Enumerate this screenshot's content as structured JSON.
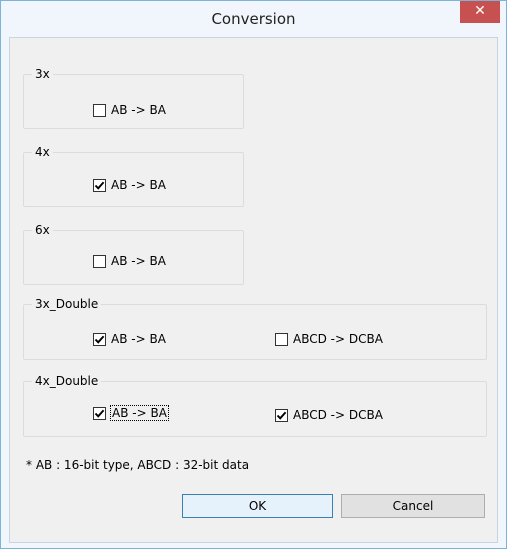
{
  "window": {
    "title": "Conversion",
    "close_glyph": "✕"
  },
  "groups": [
    {
      "legend": "3x",
      "options": [
        {
          "label": "AB -> BA",
          "checked": false
        }
      ]
    },
    {
      "legend": "4x",
      "options": [
        {
          "label": "AB -> BA",
          "checked": true
        }
      ]
    },
    {
      "legend": "6x",
      "options": [
        {
          "label": "AB -> BA",
          "checked": false
        }
      ]
    },
    {
      "legend": "3x_Double",
      "options": [
        {
          "label": "AB -> BA",
          "checked": true
        },
        {
          "label": "ABCD -> DCBA",
          "checked": false
        }
      ]
    },
    {
      "legend": "4x_Double",
      "options": [
        {
          "label": "AB -> BA",
          "checked": true
        },
        {
          "label": "ABCD -> DCBA",
          "checked": true
        }
      ]
    }
  ],
  "note": "* AB : 16-bit type, ABCD : 32-bit data",
  "buttons": {
    "ok": "OK",
    "cancel": "Cancel"
  },
  "colors": {
    "close_button": "#c75050",
    "default_button_border": "#3c7fb1"
  },
  "icons": {
    "close": "close-icon",
    "check": "checkmark-icon"
  }
}
